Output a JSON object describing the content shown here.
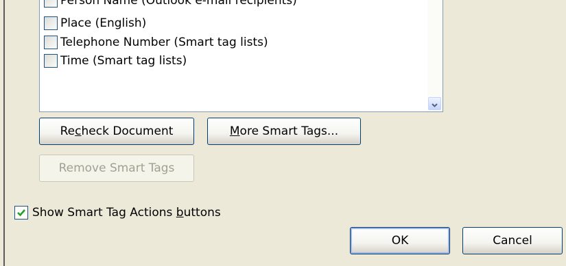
{
  "smart_tag_list": {
    "items": [
      {
        "label": "Person Name (Outlook e-mail recipients)",
        "checked": false
      },
      {
        "label": "Place (English)",
        "checked": false
      },
      {
        "label": "Telephone Number (Smart tag lists)",
        "checked": false
      },
      {
        "label": "Time (Smart tag lists)",
        "checked": false
      }
    ]
  },
  "buttons": {
    "recheck": {
      "pre": "Re",
      "accel": "c",
      "post": "heck Document"
    },
    "more_tags": {
      "pre": "",
      "accel": "M",
      "post": "ore Smart Tags..."
    },
    "remove_tags": "Remove Smart Tags",
    "ok": "OK",
    "cancel": "Cancel"
  },
  "show_actions": {
    "pre": "Show Smart Tag Actions ",
    "accel": "b",
    "post": "uttons",
    "checked": true
  },
  "colors": {
    "dialog_bg": "#ece9d8",
    "button_border": "#003c74",
    "check": "#21a121"
  },
  "icons": {
    "scroll_down": "chevron-down-icon",
    "check": "checkmark-icon"
  }
}
